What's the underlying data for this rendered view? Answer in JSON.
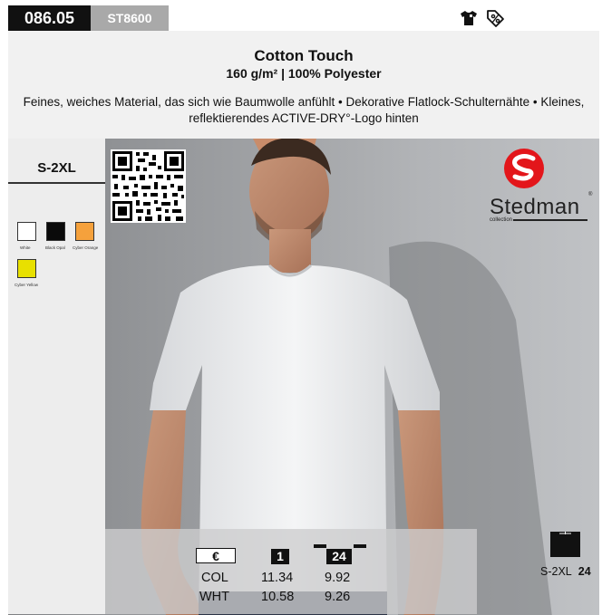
{
  "top_bar": {
    "product_code": "086.05",
    "article_code": "ST8600",
    "icons": [
      "tshirt-icon",
      "percent-tag-icon"
    ]
  },
  "header": {
    "title": "Cotton Touch",
    "subtitle": "160 g/m² | 100% Polyester",
    "description": "Feines, weiches Material, das sich wie Baumwolle anfühlt • Dekorative Flatlock-Schulternähte • Kleines, reflektierendes ACTIVE-DRY°-Logo hinten"
  },
  "sizes": "S-2XL",
  "colors": [
    {
      "name": "White",
      "hex": "#ffffff"
    },
    {
      "name": "Black Opal",
      "hex": "#0a0a0a"
    },
    {
      "name": "Cyber Orange",
      "hex": "#f5a13c"
    },
    {
      "name": "Cyber Yellow",
      "hex": "#e8e000"
    }
  ],
  "brand": {
    "name": "Stedman",
    "registered": "®",
    "sub": "collection",
    "color": "#e3161b"
  },
  "prices": {
    "currency_header": "€",
    "qty_headers": [
      "1",
      "24"
    ],
    "rows": [
      {
        "label": "COL",
        "values": [
          "11.34",
          "9.92"
        ]
      },
      {
        "label": "WHT",
        "values": [
          "10.58",
          "9.26"
        ]
      }
    ]
  },
  "pack": {
    "sizes": "S-2XL",
    "qty": "24"
  }
}
